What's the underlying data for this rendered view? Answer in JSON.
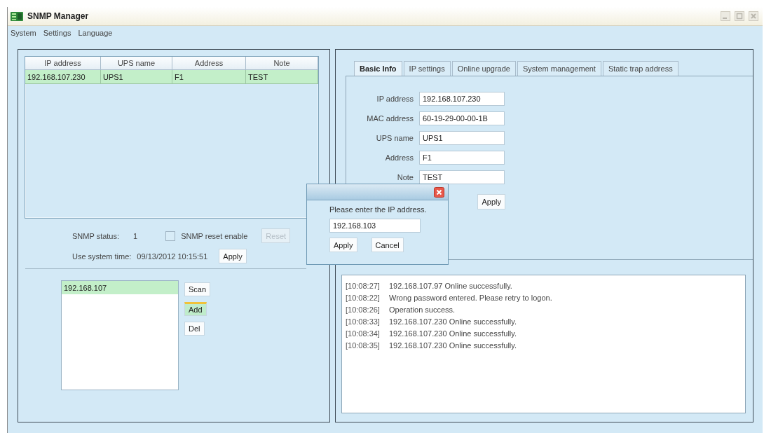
{
  "window": {
    "title": "SNMP Manager"
  },
  "menu": [
    "System",
    "Settings",
    "Language"
  ],
  "ups_table": {
    "columns": [
      "IP address",
      "UPS name",
      "Address",
      "Note"
    ],
    "rows": [
      {
        "cells": [
          "192.168.107.230",
          "UPS1",
          "F1",
          "TEST"
        ],
        "selected": true
      }
    ]
  },
  "snmp_status": {
    "label": "SNMP status:",
    "value": "1"
  },
  "reset_enable": {
    "label": "SNMP reset enable",
    "checked": false
  },
  "reset_button": {
    "label": "Reset",
    "disabled": true
  },
  "system_time": {
    "label": "Use system time:",
    "value": "09/13/2012 10:15:51",
    "button": "Apply"
  },
  "scan_list": {
    "items": [
      {
        "label": "192.168.107",
        "selected": true
      }
    ],
    "buttons": [
      {
        "label": "Scan",
        "focused": false
      },
      {
        "label": "Add",
        "focused": true
      },
      {
        "label": "Del",
        "focused": false
      }
    ]
  },
  "tabs": [
    {
      "label": "Basic Info",
      "selected": true
    },
    {
      "label": "IP settings",
      "selected": false
    },
    {
      "label": "Online upgrade",
      "selected": false
    },
    {
      "label": "System management",
      "selected": false
    },
    {
      "label": "Static trap address",
      "selected": false
    }
  ],
  "basic_info": {
    "fields": [
      {
        "label": "IP address",
        "value": "192.168.107.230"
      },
      {
        "label": "MAC address",
        "value": "60-19-29-00-00-1B"
      },
      {
        "label": "UPS name",
        "value": "UPS1"
      },
      {
        "label": "Address",
        "value": "F1"
      },
      {
        "label": "Note",
        "value": "TEST"
      }
    ],
    "button": "Apply"
  },
  "log": [
    {
      "time": "[10:08:27]",
      "message": "192.168.107.97 Online successfully."
    },
    {
      "time": "[10:08:22]",
      "message": "Wrong password entered. Please retry to logon."
    },
    {
      "time": "[10:08:26]",
      "message": "Operation success."
    },
    {
      "time": "[10:08:33]",
      "message": "192.168.107.230 Online successfully."
    },
    {
      "time": "[10:08:34]",
      "message": "192.168.107.230 Online successfully."
    },
    {
      "time": "[10:08:35]",
      "message": "192.168.107.230 Online successfully."
    }
  ],
  "dialog": {
    "message": "Please enter the IP address.",
    "value": "192.168.103",
    "buttons": [
      "Apply",
      "Cancel"
    ]
  }
}
